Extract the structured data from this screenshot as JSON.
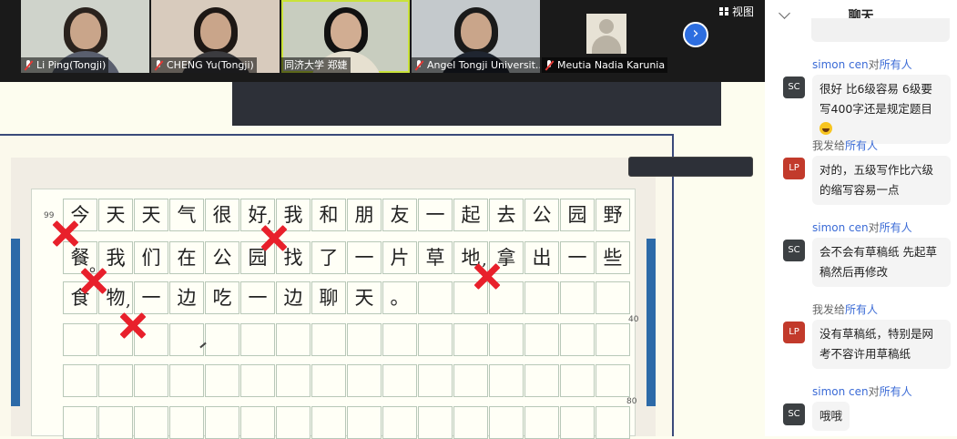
{
  "participants": [
    {
      "name": "Li Ping(Tongji)",
      "muted": true
    },
    {
      "name": "CHENG Yu(Tongji)",
      "muted": true
    },
    {
      "name": "同济大学 郑婕",
      "muted": false
    },
    {
      "name": "Angel Tongji Universit...",
      "muted": true
    },
    {
      "name": "Meutia Nadia Karunia",
      "muted": true
    }
  ],
  "view_label": "视图",
  "worksheet": {
    "line_number_start": "99",
    "row_marks": [
      "40",
      "80"
    ],
    "rows": [
      [
        "今",
        "天",
        "天",
        "气",
        "很",
        "好",
        "我",
        "和",
        "朋",
        "友",
        "一",
        "起",
        "去",
        "公",
        "园",
        "野"
      ],
      [
        "餐",
        "我",
        "们",
        "在",
        "公",
        "园",
        "找",
        "了",
        "一",
        "片",
        "草",
        "地",
        "拿",
        "出",
        "一",
        "些"
      ],
      [
        "食",
        "物",
        "一",
        "边",
        "吃",
        "一",
        "边",
        "聊",
        "天",
        "。",
        "",
        "",
        "",
        "",
        "",
        ""
      ],
      [
        "",
        "",
        "",
        "",
        "",
        "",
        "",
        "",
        "",
        "",
        "",
        "",
        "",
        "",
        "",
        ""
      ],
      [
        "",
        "",
        "",
        "",
        "",
        "",
        "",
        "",
        "",
        "",
        "",
        "",
        "",
        "",
        "",
        ""
      ],
      [
        "",
        "",
        "",
        "",
        "",
        "",
        "",
        "",
        "",
        "",
        "",
        "",
        "",
        "",
        "",
        ""
      ]
    ],
    "inserted_marks": [
      ",",
      "。",
      ",",
      ",",
      ","
    ]
  },
  "chat": {
    "title": "聊天",
    "messages": [
      {
        "sender": "simon cen",
        "to_prefix": "对",
        "to": "所有人",
        "avatar": "SC",
        "text": "很好 比6级容易 6级要写400字还是规定题目",
        "has_emoji": true
      },
      {
        "sender": "我",
        "to_prefix": "发给",
        "to": "所有人",
        "avatar": "LP",
        "text": "对的，五级写作比六级的缩写容易一点",
        "has_emoji": false
      },
      {
        "sender": "simon cen",
        "to_prefix": "对",
        "to": "所有人",
        "avatar": "SC",
        "text": "会不会有草稿纸 先起草稿然后再修改",
        "has_emoji": false
      },
      {
        "sender": "我",
        "to_prefix": "发给",
        "to": "所有人",
        "avatar": "LP",
        "text": "没有草稿纸，特别是网考不容许用草稿纸",
        "has_emoji": false
      },
      {
        "sender": "simon cen",
        "to_prefix": "对",
        "to": "所有人",
        "avatar": "SC",
        "text": "哦哦",
        "has_emoji": false
      }
    ]
  },
  "colors": {
    "accent": "#2d6ee0",
    "error_mark": "#e8202b",
    "chat_link": "#3b6bd6"
  }
}
